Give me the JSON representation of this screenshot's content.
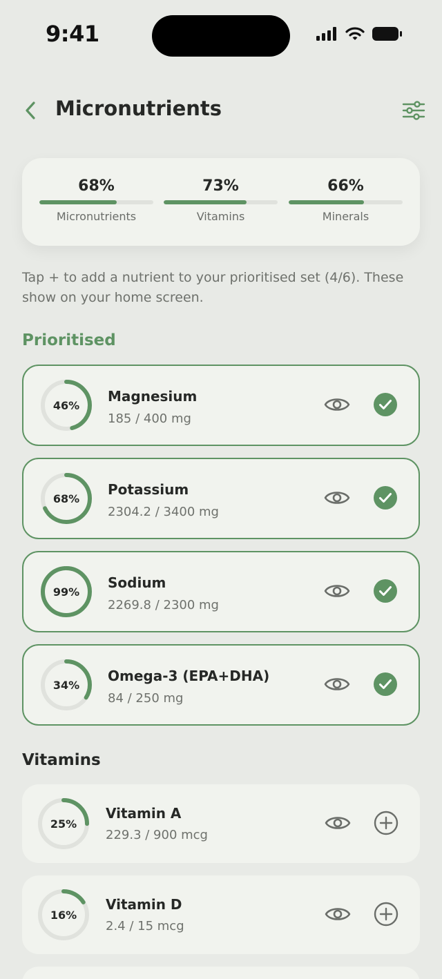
{
  "status_bar": {
    "time": "9:41"
  },
  "header": {
    "title": "Micronutrients"
  },
  "summary": [
    {
      "label": "Micronutrients",
      "value": "68%",
      "progress": 0.68
    },
    {
      "label": "Vitamins",
      "value": "73%",
      "progress": 0.73
    },
    {
      "label": "Minerals",
      "value": "66%",
      "progress": 0.66
    }
  ],
  "hint": "Tap + to add a nutrient to your prioritised set (4/6). These show on your home screen.",
  "sections": {
    "prioritised": {
      "title": "Prioritised",
      "items": [
        {
          "name": "Magnesium",
          "amount": "185 / 400 mg",
          "percent_label": "46%",
          "progress": 0.46,
          "state": "added"
        },
        {
          "name": "Potassium",
          "amount": "2304.2 / 3400 mg",
          "percent_label": "68%",
          "progress": 0.68,
          "state": "added"
        },
        {
          "name": "Sodium",
          "amount": "2269.8 / 2300 mg",
          "percent_label": "99%",
          "progress": 0.99,
          "state": "added"
        },
        {
          "name": "Omega-3 (EPA+DHA)",
          "amount": "84 / 250 mg",
          "percent_label": "34%",
          "progress": 0.34,
          "state": "added"
        }
      ]
    },
    "vitamins": {
      "title": "Vitamins",
      "items": [
        {
          "name": "Vitamin A",
          "amount": "229.3 / 900 mcg",
          "percent_label": "25%",
          "progress": 0.25,
          "state": "add"
        },
        {
          "name": "Vitamin D",
          "amount": "2.4 / 15 mcg",
          "percent_label": "16%",
          "progress": 0.16,
          "state": "add"
        }
      ]
    }
  },
  "colors": {
    "accent": "#5e9363",
    "track": "#e0e2dd",
    "card": "#f1f3ee",
    "background": "#e8eae6"
  },
  "icons": {
    "back": "chevron-left-icon",
    "filter": "sliders-icon",
    "view": "eye-icon",
    "added": "check-circle-icon",
    "add": "plus-circle-icon"
  }
}
